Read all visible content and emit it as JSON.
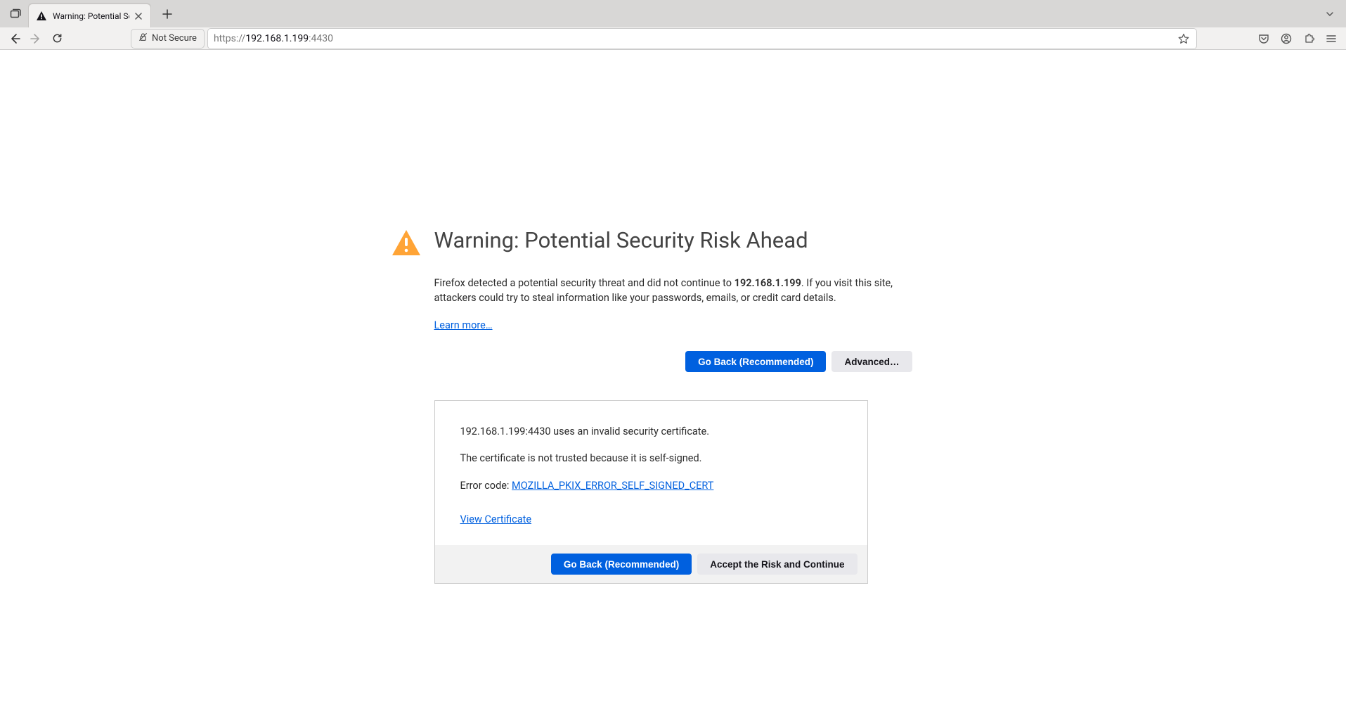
{
  "tab": {
    "title": "Warning: Potential Security Risk Ahead"
  },
  "toolbar": {
    "security_label": "Not Secure",
    "url_scheme": "https://",
    "url_host": "192.168.1.199",
    "url_port": ":4430"
  },
  "error": {
    "title": "Warning: Potential Security Risk Ahead",
    "desc_pre": "Firefox detected a potential security threat and did not continue to ",
    "desc_host": "192.168.1.199",
    "desc_post": ". If you visit this site, attackers could try to steal information like your passwords, emails, or credit card details.",
    "learn_more": "Learn more…",
    "go_back": "Go Back (Recommended)",
    "advanced": "Advanced…"
  },
  "advanced": {
    "line1": "192.168.1.199:4430 uses an invalid security certificate.",
    "line2": "The certificate is not trusted because it is self-signed.",
    "error_code_label": "Error code: ",
    "error_code": "MOZILLA_PKIX_ERROR_SELF_SIGNED_CERT",
    "view_cert": "View Certificate",
    "go_back": "Go Back (Recommended)",
    "accept": "Accept the Risk and Continue"
  }
}
